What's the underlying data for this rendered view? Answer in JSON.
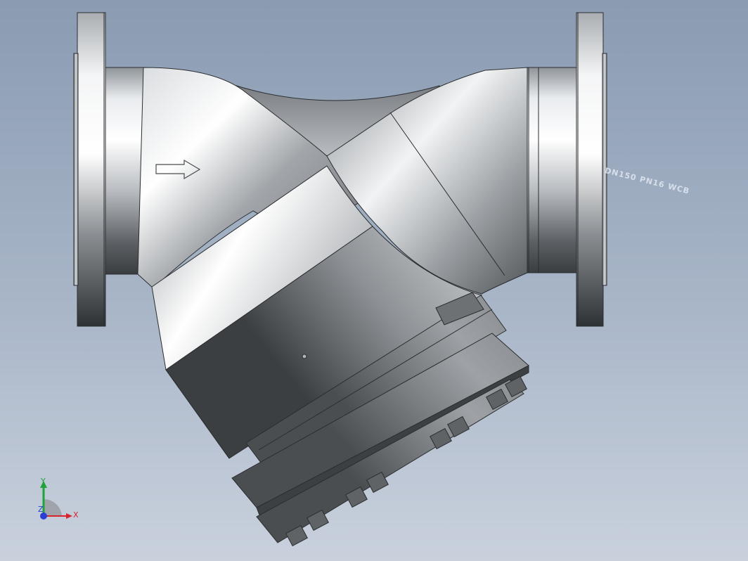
{
  "viewport": {
    "background_top": "#8a9bb2",
    "background_bottom": "#c9d1dd"
  },
  "model": {
    "name": "Y-type strainer (flanged)",
    "flow_direction_icon": "arrow-right-icon",
    "body_marking": "DN150 PN16 WCB"
  },
  "triad": {
    "x_label": "X",
    "y_label": "Y",
    "z_label": "Z",
    "x_color": "#d9232a",
    "y_color": "#1fa33a",
    "z_color": "#2a3fd6"
  }
}
